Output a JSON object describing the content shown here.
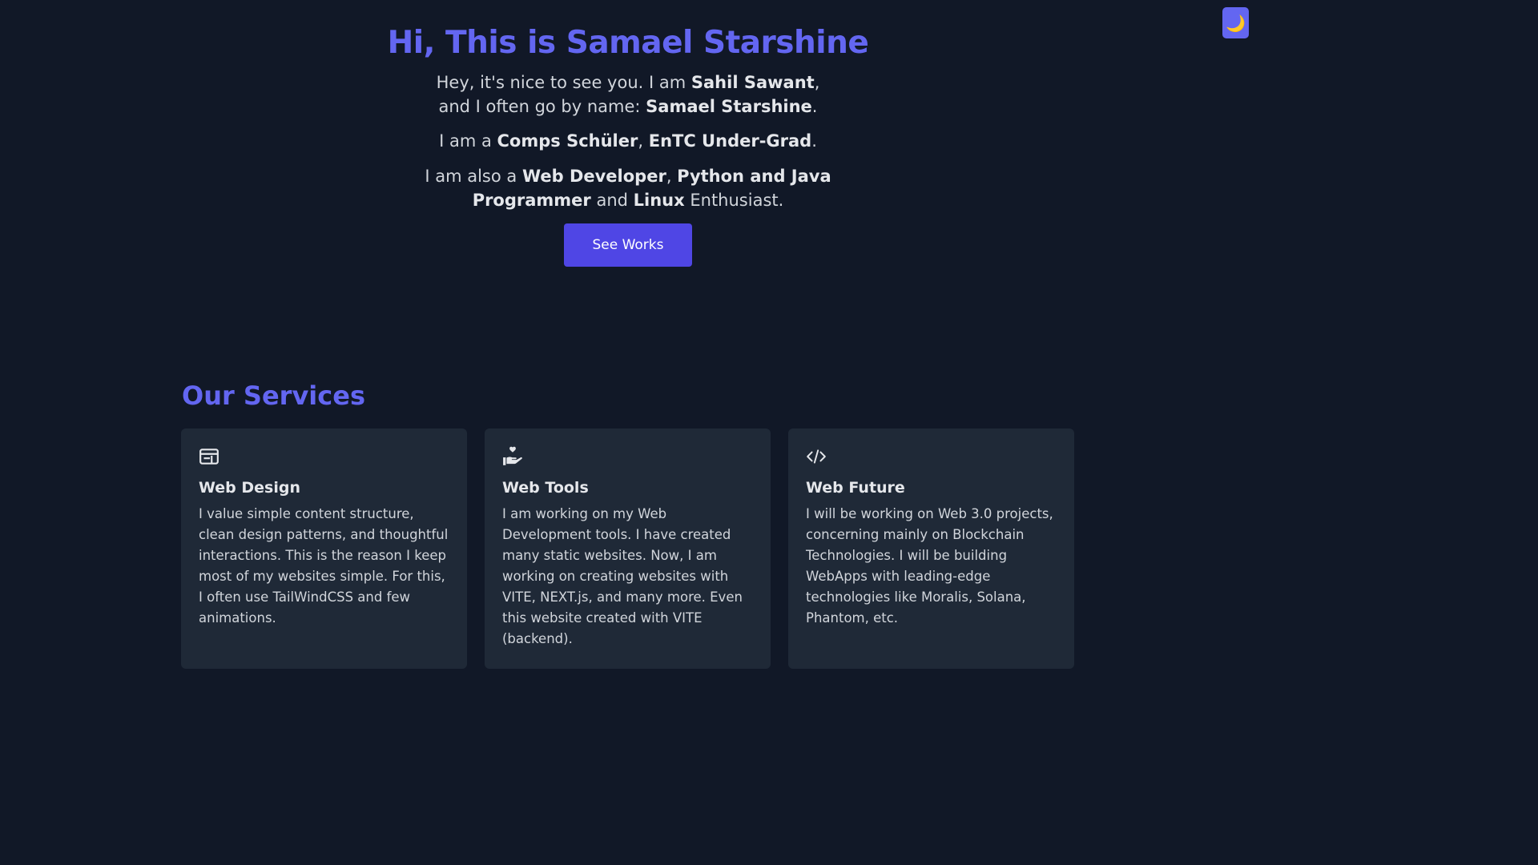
{
  "theme_toggle": {
    "icon": "moon-icon",
    "glyph": "🌙"
  },
  "hero": {
    "title": "Hi, This is Samael Starshine",
    "p1": {
      "t1": "Hey, it's nice to see you. I am ",
      "b1": "Sahil Sawant",
      "t2": ",",
      "t3": "and I often go by name: ",
      "b2": "Samael Starshine",
      "t4": "."
    },
    "p2": {
      "t1": "I am a ",
      "b1": "Comps Schüler",
      "t2": ", ",
      "b2": "EnTC Under-Grad",
      "t3": "."
    },
    "p3": {
      "t1": "I am also a ",
      "b1": "Web Developer",
      "t2": ", ",
      "b2": "Python and Java",
      "b3": "Programmer",
      "t3": " and ",
      "b4": "Linux",
      "t4": " Enthusiast."
    },
    "button_label": "See Works"
  },
  "services": {
    "title": "Our Services",
    "cards": [
      {
        "icon": "browser-window-icon",
        "title": "Web Design",
        "text": "I value simple content structure, clean design patterns, and thoughtful interactions. This is the reason I keep most of my websites simple. For this, I often use TailWindCSS and few animations."
      },
      {
        "icon": "hand-heart-icon",
        "title": "Web Tools",
        "text": "I am working on my Web Development tools. I have created many static websites. Now, I am working on creating websites with VITE, NEXT.js, and many more. Even this website created with VITE (backend)."
      },
      {
        "icon": "code-icon",
        "title": "Web Future",
        "text": "I will be working on Web 3.0 projects, concerning mainly on Blockchain Technologies. I will be building WebApps with leading-edge technologies like Moralis, Solana, Phantom, etc."
      }
    ]
  },
  "colors": {
    "background": "#111827",
    "card": "#1f2937",
    "accent": "#6366f1",
    "button": "#4f46e5",
    "text": "#d1d5db"
  }
}
